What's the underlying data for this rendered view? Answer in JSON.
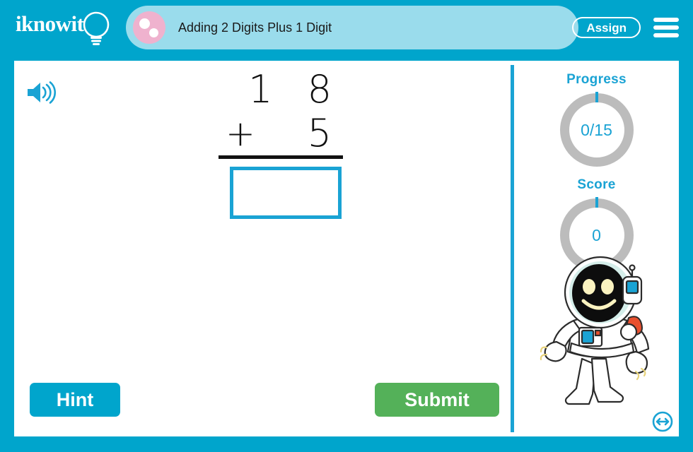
{
  "header": {
    "logo_text": "iknowit",
    "logo_icon": "lightbulb-icon",
    "title_icon": "pink-dots-icon",
    "title": "Adding 2 Digits Plus 1 Digit",
    "assign_label": "Assign",
    "menu_icon": "hamburger-menu-icon"
  },
  "work": {
    "audio_icon": "speaker-icon",
    "problem": {
      "top_number": "1 8",
      "operator": "+",
      "bottom_number": "5",
      "answer_value": "",
      "answer_placeholder": ""
    },
    "hint_label": "Hint",
    "submit_label": "Submit"
  },
  "sidebar": {
    "progress": {
      "label": "Progress",
      "value": "0/15"
    },
    "score": {
      "label": "Score",
      "value": "0"
    },
    "mascot_icon": "astronaut-mascot",
    "next_icon": "double-arrow-icon"
  },
  "colors": {
    "brand_blue": "#00a5cc",
    "light_blue": "#9adcec",
    "accent_blue": "#1aa3d4",
    "submit_green": "#54b159",
    "pink": "#efb2ce",
    "ring_gray": "#bcbcbc"
  }
}
